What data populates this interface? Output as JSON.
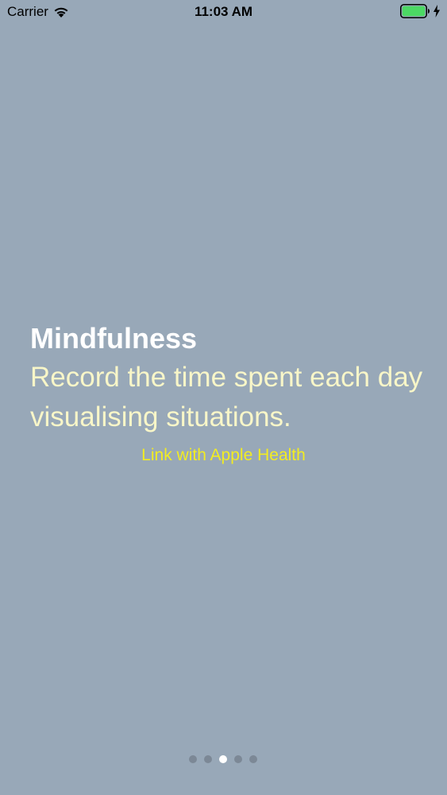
{
  "status_bar": {
    "carrier": "Carrier",
    "time": "11:03 AM",
    "wifi_icon": "wifi-icon",
    "battery_icon": "battery-icon",
    "charging_icon": "bolt-icon",
    "battery_level": 1.0,
    "battery_color": "#4CD964"
  },
  "onboarding": {
    "title": "Mindfulness",
    "description": "Record the time spent each day visualising situations.",
    "link_label": "Link with Apple Health"
  },
  "page_control": {
    "page_count": 5,
    "current_page": 3
  },
  "colors": {
    "background": "#98A8B8",
    "title": "#FFFFFF",
    "description": "#F8F6C8",
    "link": "#F2EC22",
    "dot_inactive": "#7C8896",
    "dot_active": "#FFFFFF"
  }
}
